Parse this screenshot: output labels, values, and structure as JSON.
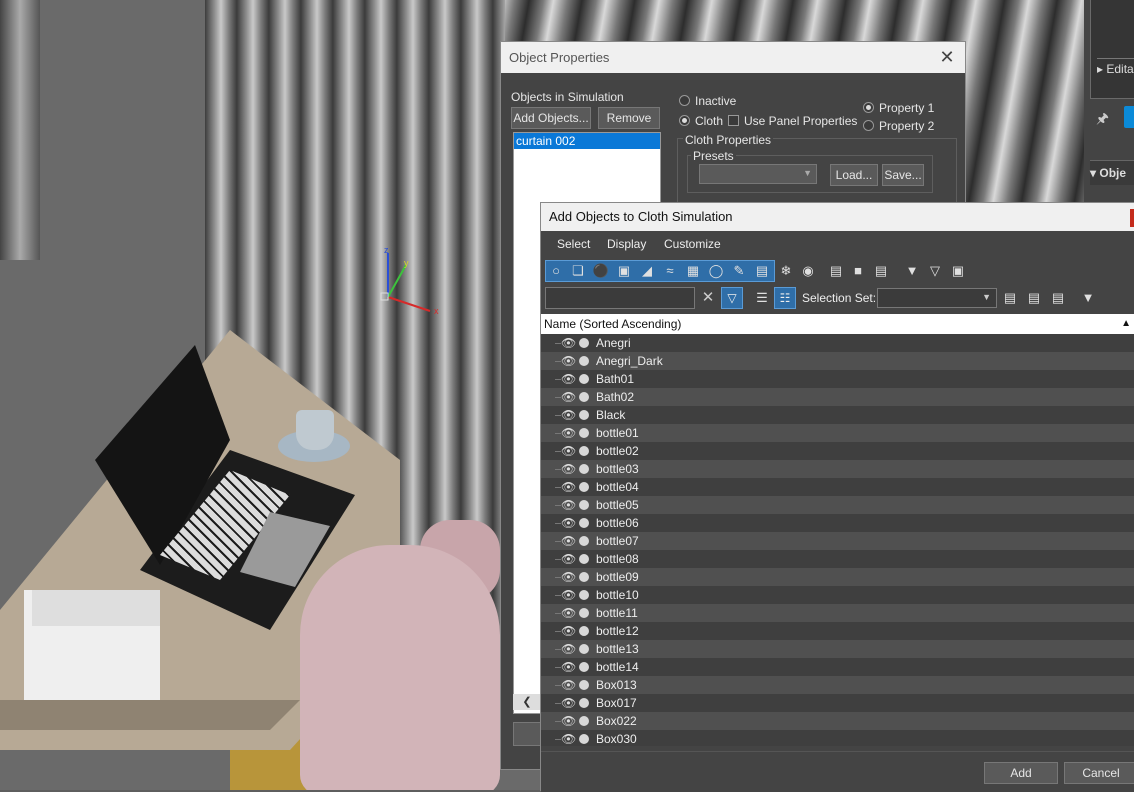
{
  "object_properties": {
    "title": "Object Properties",
    "objects_label": "Objects in Simulation",
    "add_objects_label": "Add Objects...",
    "remove_label": "Remove",
    "sim_objects": [
      "curtain 002"
    ],
    "inactive_label": "Inactive",
    "cloth_label": "Cloth",
    "use_panel_label": "Use Panel Properties",
    "property1_label": "Property 1",
    "property2_label": "Property 2",
    "cloth_props_label": "Cloth Properties",
    "presets_label": "Presets",
    "load_label": "Load...",
    "save_label": "Save..."
  },
  "add_dialog": {
    "title": "Add Objects to Cloth Simulation",
    "menu": {
      "select": "Select",
      "display": "Display",
      "customize": "Customize"
    },
    "selection_set_label": "Selection Set:",
    "column_header": "Name (Sorted Ascending)",
    "add_label": "Add",
    "cancel_label": "Cancel",
    "objects": [
      "Anegri",
      "Anegri_Dark",
      "Bath01",
      "Bath02",
      "Black",
      "bottle01",
      "bottle02",
      "bottle03",
      "bottle04",
      "bottle05",
      "bottle06",
      "bottle07",
      "bottle08",
      "bottle09",
      "bottle10",
      "bottle11",
      "bottle12",
      "bottle13",
      "bottle14",
      "Box013",
      "Box017",
      "Box022",
      "Box030"
    ]
  },
  "command_panel": {
    "editable_label": "Edita",
    "objects_label": "Obje"
  },
  "gizmo": {
    "x": "x",
    "y": "y",
    "z": "z"
  }
}
